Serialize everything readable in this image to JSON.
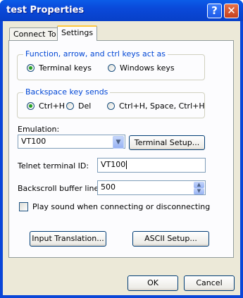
{
  "window": {
    "title": "test Properties",
    "help_glyph": "?",
    "close_glyph": "✕"
  },
  "tabs": [
    {
      "label": "Connect To"
    },
    {
      "label": "Settings"
    }
  ],
  "keys_group": {
    "title": "Function, arrow, and ctrl keys act as",
    "options": [
      {
        "label": "Terminal keys",
        "selected": true
      },
      {
        "label": "Windows keys",
        "selected": false
      }
    ]
  },
  "backspace_group": {
    "title": "Backspace key sends",
    "options": [
      {
        "label": "Ctrl+H",
        "selected": true
      },
      {
        "label": "Del",
        "selected": false
      },
      {
        "label": "Ctrl+H, Space, Ctrl+H",
        "selected": false
      }
    ]
  },
  "emulation": {
    "label": "Emulation:",
    "value": "VT100",
    "setup_button": "Terminal Setup..."
  },
  "telnet": {
    "label": "Telnet terminal ID:",
    "value": "VT100"
  },
  "backscroll": {
    "label": "Backscroll buffer lines:",
    "value": "500"
  },
  "play_sound": {
    "label": "Play sound when connecting or disconnecting",
    "checked": false
  },
  "buttons": {
    "input_translation": "Input Translation...",
    "ascii_setup": "ASCII Setup...",
    "ok": "OK",
    "cancel": "Cancel"
  },
  "icons": {
    "dropdown": "chevron-down-icon",
    "spin_up": "arrow-up-icon",
    "spin_down": "arrow-down-icon"
  }
}
